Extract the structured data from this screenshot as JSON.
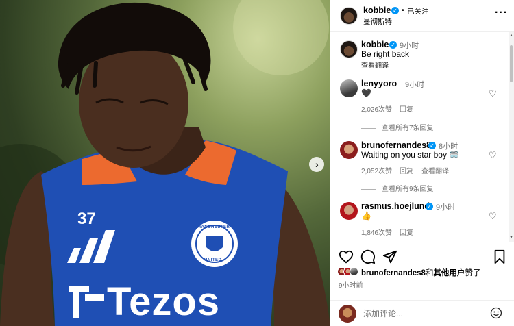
{
  "photo": {
    "jersey_number": "37",
    "sponsor_text": "Tezos",
    "crest_text_top": "MANCHESTER",
    "crest_text_bottom": "UNITED",
    "next_arrow": "›"
  },
  "post": {
    "author": "kobbie",
    "separator": "•",
    "follow_status": "已关注",
    "location": "曼彻斯特",
    "more_icon": "more-horizontal-icon",
    "caption": {
      "author": "kobbie",
      "time": "9小时",
      "text": "Be right back",
      "translate": "查看翻译"
    }
  },
  "comments": [
    {
      "user": "lenyyoro",
      "verified": false,
      "time": "9小时",
      "text": "🖤",
      "likes": "2,026次赞",
      "reply": "回复",
      "translate": "",
      "view_replies": "查看所有7条回复"
    },
    {
      "user": "brunofernandes8",
      "verified": true,
      "time": "8小时",
      "text": "Waiting on you star boy 🥽",
      "likes": "2,052次赞",
      "reply": "回复",
      "translate": "查看翻译",
      "view_replies": "查看所有9条回复"
    },
    {
      "user": "rasmus.hoejlund",
      "verified": true,
      "time": "9小时",
      "text": "👍",
      "likes": "1,846次赞",
      "reply": "回复",
      "translate": "",
      "view_replies": ""
    }
  ],
  "actions": {
    "liked_by_user": "brunofernandes8",
    "liked_by_joiner": "和",
    "liked_by_others": "其他用户",
    "liked_by_suffix": "赞了",
    "post_time": "9小时前"
  },
  "add_comment": {
    "placeholder": "添加评论..."
  },
  "colors": {
    "verified_blue": "#0095f6",
    "secondary_text": "#737373",
    "jersey_blue": "#1f4fb4",
    "jersey_orange": "#ec6a2f"
  }
}
